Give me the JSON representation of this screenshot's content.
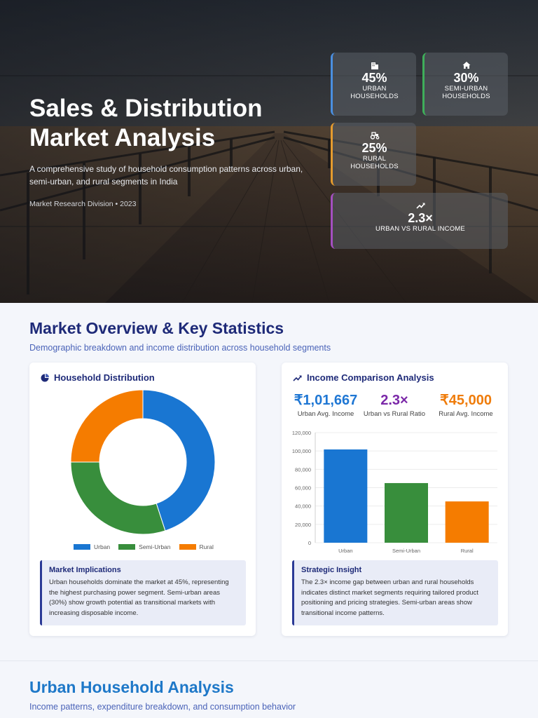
{
  "hero": {
    "title_line1": "Sales & Distribution",
    "title_line2": "Market Analysis",
    "description": "A comprehensive study of household consumption patterns across urban, semi-urban, and rural segments in India",
    "meta": "Market Research Division • 2023",
    "stats": [
      {
        "value": "45%",
        "label_line1": "URBAN",
        "label_line2": "HOUSEHOLDS",
        "icon": "building-icon",
        "accent": "#4a8fe0"
      },
      {
        "value": "30%",
        "label_line1": "SEMI-URBAN",
        "label_line2": "HOUSEHOLDS",
        "icon": "home-icon",
        "accent": "#3fae5a"
      },
      {
        "value": "25%",
        "label_line1": "RURAL",
        "label_line2": "HOUSEHOLDS",
        "icon": "tractor-icon",
        "accent": "#e59b2e"
      },
      {
        "value": "2.3×",
        "label_line1": "URBAN VS RURAL INCOME",
        "label_line2": "",
        "icon": "trend-up-icon",
        "accent": "#a44fc0"
      }
    ]
  },
  "overview": {
    "title": "Market Overview & Key Statistics",
    "subtitle": "Demographic breakdown and income distribution across household segments",
    "distribution_card": {
      "title": "Household Distribution",
      "icon": "pie-chart-icon",
      "insight_title": "Market Implications",
      "insight_body": "Urban households dominate the market at 45%, representing the highest purchasing power segment. Semi-urban areas (30%) show growth potential as transitional markets with increasing disposable income."
    },
    "income_card": {
      "title": "Income Comparison Analysis",
      "icon": "trend-up-icon",
      "kpis": [
        {
          "value": "₹1,01,667",
          "label": "Urban Avg. Income",
          "color": "#1f77d4"
        },
        {
          "value": "2.3×",
          "label": "Urban vs Rural Ratio",
          "color": "#7b28a8"
        },
        {
          "value": "₹45,000",
          "label": "Rural Avg. Income",
          "color": "#ef7c0a"
        }
      ],
      "insight_title": "Strategic Insight",
      "insight_body": "The 2.3× income gap between urban and rural households indicates distinct market segments requiring tailored product positioning and pricing strategies. Semi-urban areas show transitional income patterns."
    }
  },
  "urban": {
    "title": "Urban Household Analysis",
    "subtitle": "Income patterns, expenditure breakdown, and consumption behavior"
  },
  "colors": {
    "urban": "#1976d2",
    "semi_urban": "#388e3c",
    "rural": "#f57c00",
    "heading_navy": "#1e2a78",
    "heading_blue": "#1e78c8"
  },
  "chart_data": [
    {
      "type": "pie",
      "title": "Household Distribution",
      "categories": [
        "Urban",
        "Semi-Urban",
        "Rural"
      ],
      "values": [
        45,
        30,
        25
      ],
      "legend": "bottom"
    },
    {
      "type": "bar",
      "title": "Income Comparison Analysis",
      "categories": [
        "Urban",
        "Semi-Urban",
        "Rural"
      ],
      "values": [
        101667,
        65000,
        45000
      ],
      "ylim": [
        0,
        120000
      ],
      "yticks": [
        "0",
        "20,000",
        "40,000",
        "60,000",
        "80,000",
        "100,000",
        "120,000"
      ],
      "grid": true
    }
  ]
}
